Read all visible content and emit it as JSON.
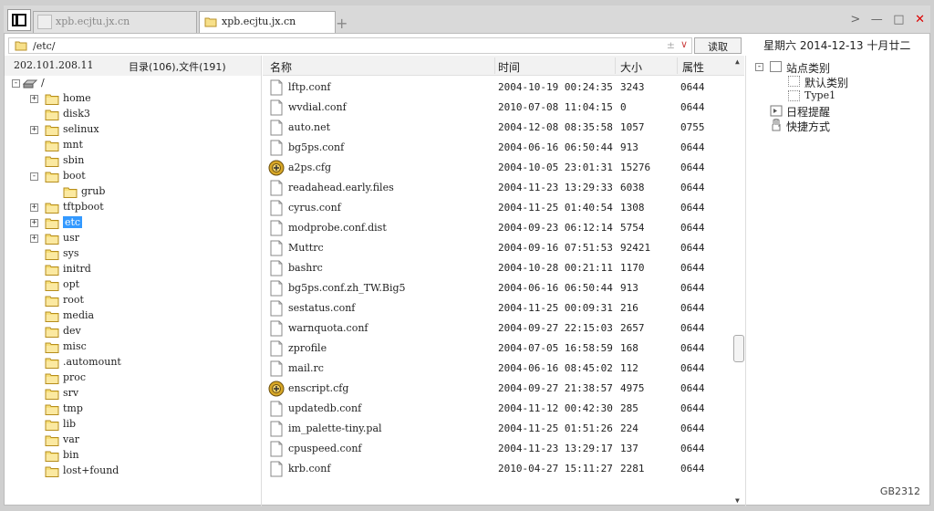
{
  "tabs": [
    {
      "label": "xpb.ecjtu.jx.cn",
      "active": false
    },
    {
      "label": "xpb.ecjtu.jx.cn",
      "active": true
    }
  ],
  "new_tab_label": "+",
  "window_controls": {
    "next": ">",
    "minimize": "—",
    "maximize": "□",
    "close": "✕"
  },
  "address": {
    "path": "/etc/",
    "plusminus": "±",
    "dropdown": "∨"
  },
  "read_button": "读取",
  "date_header": "星期六 2014-12-13 十月廿二",
  "left": {
    "ip": "202.101.208.11",
    "count": "目录(106),文件(191)",
    "tree": [
      {
        "label": "/",
        "level": 0,
        "expander": "-",
        "icon": "drive-icon"
      },
      {
        "label": "home",
        "level": 1,
        "expander": "+"
      },
      {
        "label": "disk3",
        "level": 1,
        "expander": ""
      },
      {
        "label": "selinux",
        "level": 1,
        "expander": "+"
      },
      {
        "label": "mnt",
        "level": 1,
        "expander": ""
      },
      {
        "label": "sbin",
        "level": 1,
        "expander": ""
      },
      {
        "label": "boot",
        "level": 1,
        "expander": "-"
      },
      {
        "label": "grub",
        "level": 2,
        "expander": ""
      },
      {
        "label": "tftpboot",
        "level": 1,
        "expander": "+"
      },
      {
        "label": "etc",
        "level": 1,
        "expander": "+",
        "selected": true
      },
      {
        "label": "usr",
        "level": 1,
        "expander": "+"
      },
      {
        "label": "sys",
        "level": 1,
        "expander": ""
      },
      {
        "label": "initrd",
        "level": 1,
        "expander": ""
      },
      {
        "label": "opt",
        "level": 1,
        "expander": ""
      },
      {
        "label": "root",
        "level": 1,
        "expander": ""
      },
      {
        "label": "media",
        "level": 1,
        "expander": ""
      },
      {
        "label": "dev",
        "level": 1,
        "expander": ""
      },
      {
        "label": "misc",
        "level": 1,
        "expander": ""
      },
      {
        "label": ".automount",
        "level": 1,
        "expander": ""
      },
      {
        "label": "proc",
        "level": 1,
        "expander": ""
      },
      {
        "label": "srv",
        "level": 1,
        "expander": ""
      },
      {
        "label": "tmp",
        "level": 1,
        "expander": ""
      },
      {
        "label": "lib",
        "level": 1,
        "expander": ""
      },
      {
        "label": "var",
        "level": 1,
        "expander": ""
      },
      {
        "label": "bin",
        "level": 1,
        "expander": ""
      },
      {
        "label": "lost+found",
        "level": 1,
        "expander": ""
      }
    ]
  },
  "list": {
    "columns": {
      "name": "名称",
      "time": "时间",
      "size": "大小",
      "attr": "属性"
    },
    "rows": [
      {
        "name": "lftp.conf",
        "time": "2004-10-19 00:24:35",
        "size": "3243",
        "attr": "0644",
        "icon": "document-icon"
      },
      {
        "name": "wvdial.conf",
        "time": "2010-07-08 11:04:15",
        "size": "0",
        "attr": "0644",
        "icon": "document-icon"
      },
      {
        "name": "auto.net",
        "time": "2004-12-08 08:35:58",
        "size": "1057",
        "attr": "0755",
        "icon": "document-icon"
      },
      {
        "name": "bg5ps.conf",
        "time": "2004-06-16 06:50:44",
        "size": "913",
        "attr": "0644",
        "icon": "document-icon"
      },
      {
        "name": "a2ps.cfg",
        "time": "2004-10-05 23:01:31",
        "size": "15276",
        "attr": "0644",
        "icon": "config-icon"
      },
      {
        "name": "readahead.early.files",
        "time": "2004-11-23 13:29:33",
        "size": "6038",
        "attr": "0644",
        "icon": "document-icon"
      },
      {
        "name": "cyrus.conf",
        "time": "2004-11-25 01:40:54",
        "size": "1308",
        "attr": "0644",
        "icon": "document-icon"
      },
      {
        "name": "modprobe.conf.dist",
        "time": "2004-09-23 06:12:14",
        "size": "5754",
        "attr": "0644",
        "icon": "document-icon"
      },
      {
        "name": "Muttrc",
        "time": "2004-09-16 07:51:53",
        "size": "92421",
        "attr": "0644",
        "icon": "document-icon"
      },
      {
        "name": "bashrc",
        "time": "2004-10-28 00:21:11",
        "size": "1170",
        "attr": "0644",
        "icon": "document-icon"
      },
      {
        "name": "bg5ps.conf.zh_TW.Big5",
        "time": "2004-06-16 06:50:44",
        "size": "913",
        "attr": "0644",
        "icon": "document-icon"
      },
      {
        "name": "sestatus.conf",
        "time": "2004-11-25 00:09:31",
        "size": "216",
        "attr": "0644",
        "icon": "document-icon"
      },
      {
        "name": "warnquota.conf",
        "time": "2004-09-27 22:15:03",
        "size": "2657",
        "attr": "0644",
        "icon": "document-icon"
      },
      {
        "name": "zprofile",
        "time": "2004-07-05 16:58:59",
        "size": "168",
        "attr": "0644",
        "icon": "document-icon"
      },
      {
        "name": "mail.rc",
        "time": "2004-06-16 08:45:02",
        "size": "112",
        "attr": "0644",
        "icon": "document-icon"
      },
      {
        "name": "enscript.cfg",
        "time": "2004-09-27 21:38:57",
        "size": "4975",
        "attr": "0644",
        "icon": "config-icon"
      },
      {
        "name": "updatedb.conf",
        "time": "2004-11-12 00:42:30",
        "size": "285",
        "attr": "0644",
        "icon": "document-icon"
      },
      {
        "name": "im_palette-tiny.pal",
        "time": "2004-11-25 01:51:26",
        "size": "224",
        "attr": "0644",
        "icon": "document-icon"
      },
      {
        "name": "cpuspeed.conf",
        "time": "2004-11-23 13:29:17",
        "size": "137",
        "attr": "0644",
        "icon": "document-icon"
      },
      {
        "name": "krb.conf",
        "time": "2010-04-27 15:11:27",
        "size": "2281",
        "attr": "0644",
        "icon": "document-icon"
      }
    ]
  },
  "right": {
    "site_category": "站点类别",
    "default_category": "默认类别",
    "type1": "Type1",
    "schedule": "日程提醒",
    "shortcuts": "快捷方式"
  },
  "footer": "GB2312",
  "colors": {
    "selection": "#3399ff",
    "folder": "#f2c94c",
    "close": "#dd0000"
  }
}
